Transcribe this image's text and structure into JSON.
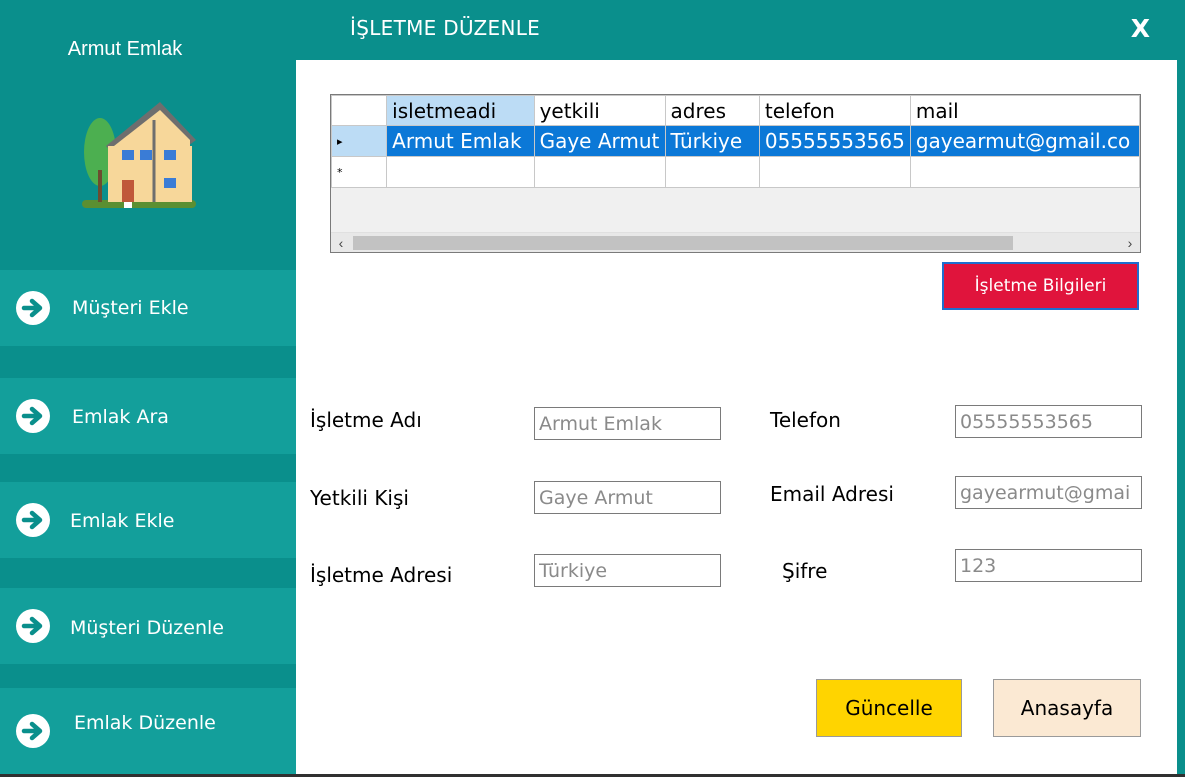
{
  "sidebar": {
    "brand": "Armut Emlak",
    "items": [
      {
        "label": "Müşteri Ekle"
      },
      {
        "label": "Emlak Ara"
      },
      {
        "label": "Emlak Ekle"
      },
      {
        "label": "Müşteri Düzenle"
      },
      {
        "label": "Emlak Düzenle"
      }
    ]
  },
  "header": {
    "title": "İŞLETME DÜZENLE",
    "close_label": "X"
  },
  "grid": {
    "columns": [
      "isletmeadi",
      "yetkili",
      "adres",
      "telefon",
      "mail"
    ],
    "rows": [
      [
        "Armut Emlak",
        "Gaye Armut",
        "Türkiye",
        "05555553565",
        "gayearmut@gmail.co"
      ]
    ],
    "selected_row_marker": "▸",
    "new_row_marker": "*"
  },
  "buttons": {
    "info": "İşletme Bilgileri",
    "update": "Güncelle",
    "home": "Anasayfa"
  },
  "form": {
    "business_name": {
      "label": "İşletme Adı",
      "value": "Armut Emlak"
    },
    "contact_person": {
      "label": "Yetkili Kişi",
      "value": "Gaye Armut"
    },
    "business_address": {
      "label": "İşletme Adresi",
      "value": "Türkiye"
    },
    "phone": {
      "label": "Telefon",
      "value": "05555553565"
    },
    "email": {
      "label": "Email Adresi",
      "value": "gayearmut@gmai"
    },
    "password": {
      "label": "Şifre",
      "value": "123"
    }
  },
  "colors": {
    "sidebar": "#0a8f8c",
    "nav_item": "#139f9b",
    "selected_row": "#0b78d7",
    "info_button": "#e0143c",
    "update_button": "#ffd400",
    "home_button": "#fbe9d3"
  }
}
